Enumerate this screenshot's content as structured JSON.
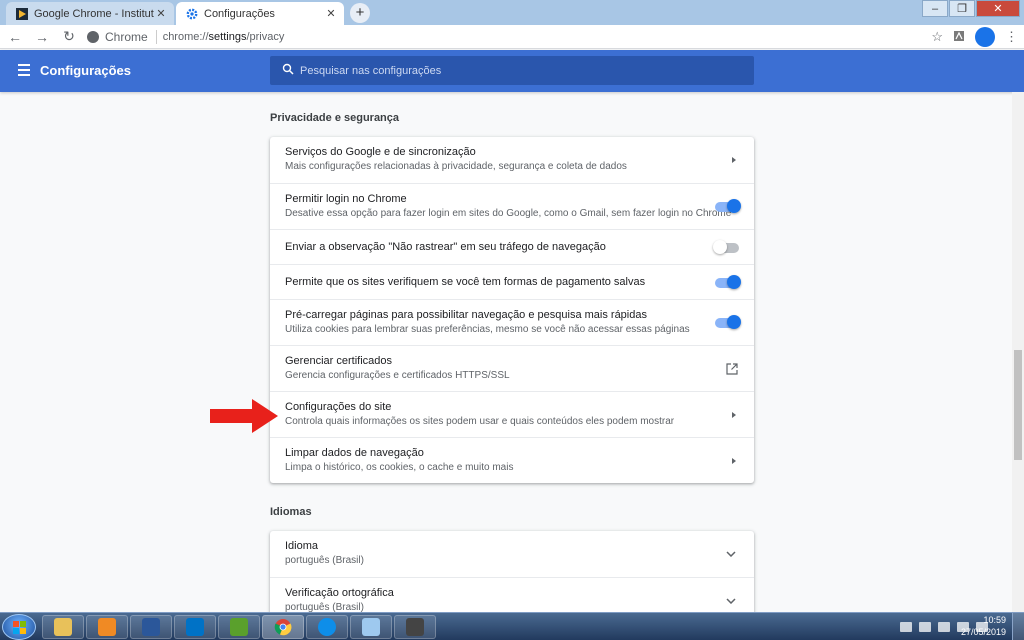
{
  "tabs": [
    {
      "title": "Google Chrome - Instituto Nacio",
      "icon": "media-player-favicon-icon",
      "active": false
    },
    {
      "title": "Configurações",
      "icon": "gear-favicon-icon",
      "active": true
    }
  ],
  "toolbar": {
    "site_label": "Chrome",
    "url_prefix": "chrome://",
    "url_host": "settings",
    "url_path": "/privacy"
  },
  "header": {
    "title": "Configurações",
    "search_placeholder": "Pesquisar nas configurações"
  },
  "privacy": {
    "section_title": "Privacidade e segurança",
    "rows": [
      {
        "primary": "Serviços do Google e de sincronização",
        "secondary": "Mais configurações relacionadas à privacidade, segurança e coleta de dados",
        "control": "arrow"
      },
      {
        "primary": "Permitir login no Chrome",
        "secondary": "Desative essa opção para fazer login em sites do Google, como o Gmail, sem fazer login no Chrome",
        "control": "toggle",
        "enabled": true
      },
      {
        "primary": "Enviar a observação \"Não rastrear\" em seu tráfego de navegação",
        "secondary": "",
        "control": "toggle",
        "enabled": false
      },
      {
        "primary": "Permite que os sites verifiquem se você tem formas de pagamento salvas",
        "secondary": "",
        "control": "toggle",
        "enabled": true
      },
      {
        "primary": "Pré-carregar páginas para possibilitar navegação e pesquisa mais rápidas",
        "secondary": "Utiliza cookies para lembrar suas preferências, mesmo se você não acessar essas páginas",
        "control": "toggle",
        "enabled": true
      },
      {
        "primary": "Gerenciar certificados",
        "secondary": "Gerencia configurações e certificados HTTPS/SSL",
        "control": "external"
      },
      {
        "primary": "Configurações do site",
        "secondary": "Controla quais informações os sites podem usar e quais conteúdos eles podem mostrar",
        "control": "arrow"
      },
      {
        "primary": "Limpar dados de navegação",
        "secondary": "Limpa o histórico, os cookies, o cache e muito mais",
        "control": "arrow"
      }
    ]
  },
  "languages": {
    "section_title": "Idiomas",
    "rows": [
      {
        "primary": "Idioma",
        "secondary": "português (Brasil)",
        "control": "chevron"
      },
      {
        "primary": "Verificação ortográfica",
        "secondary": "português (Brasil)",
        "control": "chevron"
      }
    ]
  },
  "annotation": {
    "color": "#e8211b"
  },
  "colors": {
    "header": "#3c6fd3",
    "accent": "#1a73e8"
  },
  "taskbar": {
    "apps": [
      "windows-explorer-icon",
      "media-player-icon",
      "word-icon",
      "outlook-icon",
      "vnc-icon",
      "chrome-icon",
      "teamviewer-icon",
      "notepad-icon",
      "camera-icon"
    ],
    "time": "10:59",
    "date": "27/05/2019"
  }
}
